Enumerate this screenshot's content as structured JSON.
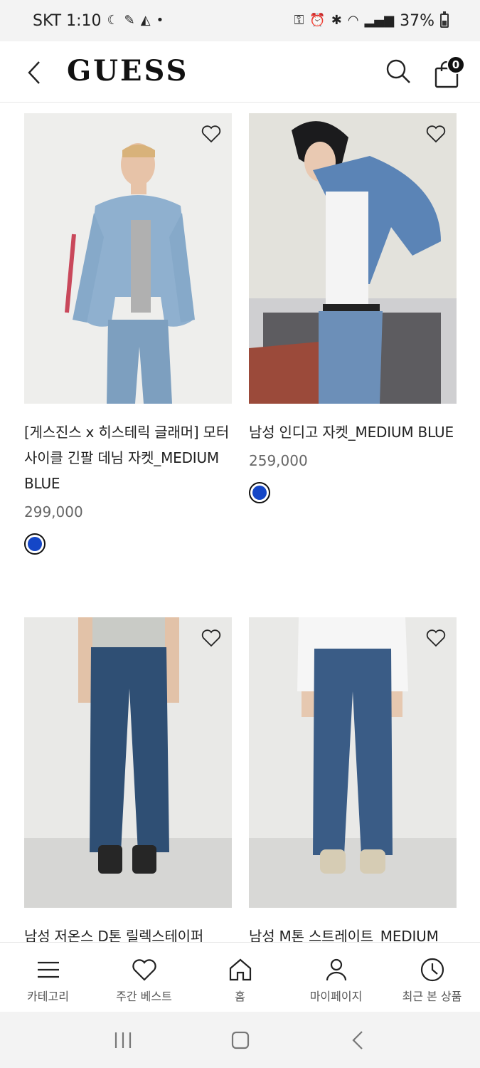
{
  "status_bar": {
    "carrier_time": "SKT 1:10",
    "battery": "37%"
  },
  "header": {
    "logo": "GUESS",
    "cart_count": "0"
  },
  "products": [
    {
      "name": "[게스진스 x 히스테릭 글래머] 모터사이클 긴팔 데님 자켓_MEDIUM BLUE",
      "price": "299,000",
      "swatch_color": "#1446c7"
    },
    {
      "name": "남성 인디고 자켓_MEDIUM BLUE",
      "price": "259,000",
      "swatch_color": "#1446c7"
    },
    {
      "name": "남성 저온스 D톤 릴렉스테이퍼"
    },
    {
      "name": "남성 M톤 스트레이트_MEDIUM"
    }
  ],
  "bottom_nav": [
    {
      "label": "카테고리",
      "icon": "menu-icon"
    },
    {
      "label": "주간 베스트",
      "icon": "heart-icon"
    },
    {
      "label": "홈",
      "icon": "home-icon"
    },
    {
      "label": "마이페이지",
      "icon": "user-icon"
    },
    {
      "label": "최근 본 상품",
      "icon": "clock-icon"
    }
  ]
}
